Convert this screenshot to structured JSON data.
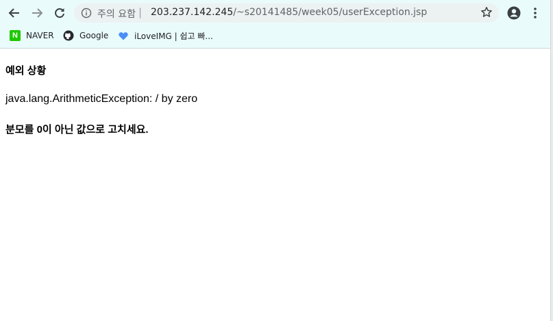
{
  "browser": {
    "security_label": "주의 요함",
    "separator": "|",
    "url_host": "203.237.142.245",
    "url_path": "/~s20141485/week05/userException.jsp",
    "bookmarks": [
      {
        "label": "NAVER",
        "icon": "naver-icon"
      },
      {
        "label": "Google",
        "icon": "github-icon"
      },
      {
        "label": "iLoveIMG | 쉽고 빠...",
        "icon": "heart-icon"
      }
    ]
  },
  "page": {
    "title": "예외 상황",
    "exception": "java.lang.ArithmeticException: / by zero",
    "message": "분모를 0이 아닌 값으로 고치세요."
  }
}
